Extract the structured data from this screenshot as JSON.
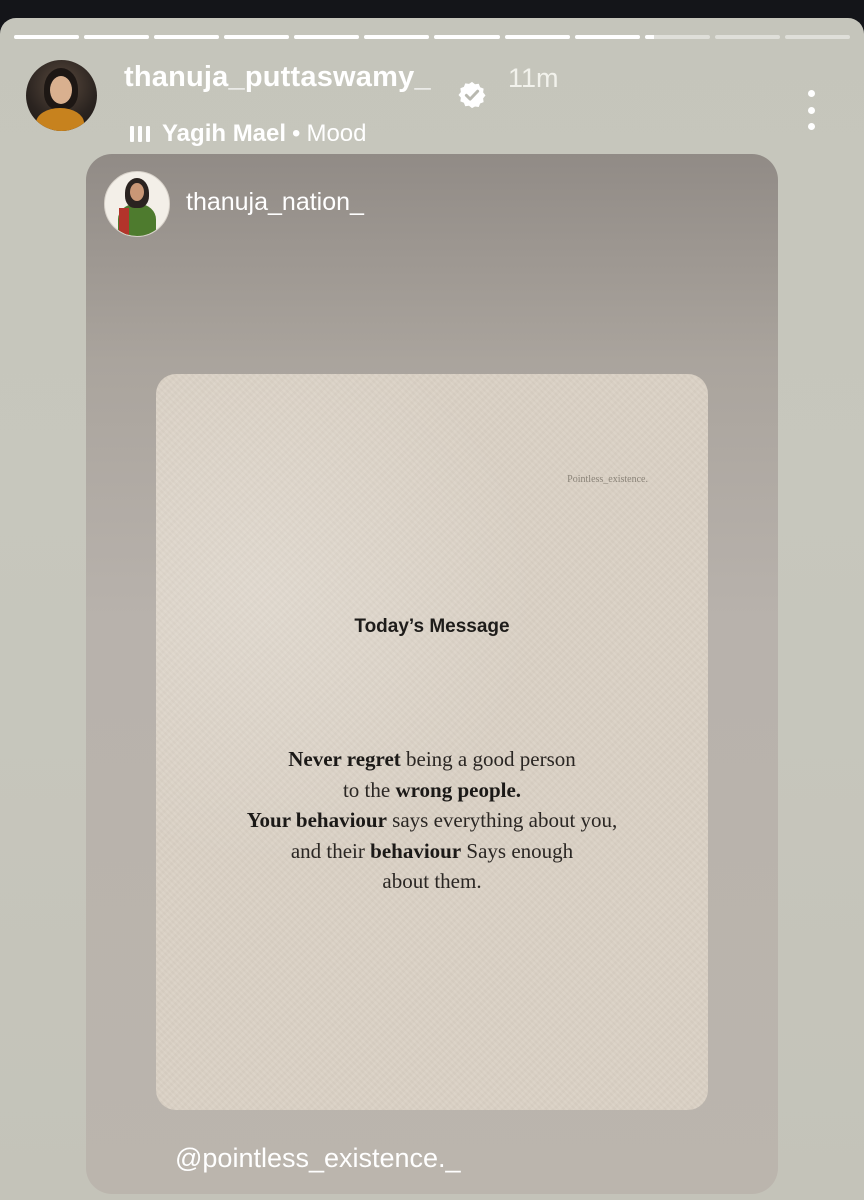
{
  "progress": {
    "segments": [
      1,
      1,
      1,
      1,
      1,
      1,
      1,
      1,
      1,
      0.15,
      0,
      0
    ]
  },
  "header": {
    "username": "thanuja_puttaswamy_",
    "verified_icon": "verified-badge-icon",
    "time": "11m",
    "music": {
      "icon": "music-bars-icon",
      "artist": "Yagih Mael",
      "separator": "•",
      "track": "Mood"
    },
    "more_icon": "more-vertical-icon"
  },
  "shared_post": {
    "username": "thanuja_nation_",
    "image": {
      "watermark": "Pointless_existence.",
      "title": "Today’s Message",
      "quote": {
        "line1_bold": "Never regret",
        "line1_rest": " being a good person",
        "line2_start": "to the ",
        "line2_bold": "wrong people.",
        "line3_bold": "Your behaviour",
        "line3_rest": " says everything about you,",
        "line4_start": "and their ",
        "line4_bold": "behaviour",
        "line4_rest": " Says enough",
        "line5": "about them."
      }
    },
    "mention": "@pointless_existence._"
  },
  "colors": {
    "background": "#c6c6bc",
    "card": "#b8b2ac",
    "paper": "#dbd2c6",
    "text_light": "#ffffff"
  }
}
